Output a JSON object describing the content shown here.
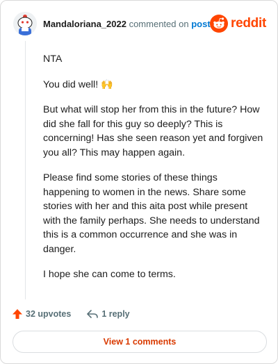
{
  "header": {
    "username": "Mandaloriana_2022",
    "verb": "commented on",
    "post_link": "post",
    "brand": "reddit"
  },
  "comment": {
    "paragraphs": [
      "NTA",
      "You did well! 🙌",
      "But what will stop her from this in the future? How did she fall for this guy so deeply? This is concerning! Has she seen reason yet and forgiven you all? This may happen again.",
      "Please find some stories of these things happening to women in the news. Share some stories with her and this aita post while present with the family perhaps. She needs to understand this is a common occurrence and she was in danger.",
      "I hope she can come to terms."
    ]
  },
  "actions": {
    "upvotes": "32 upvotes",
    "replies": "1 reply"
  },
  "footer": {
    "view_comments": "View 1 comments"
  },
  "colors": {
    "brand": "#ff4500",
    "link": "#0079d3",
    "upvote": "#ff4500",
    "view_button_text": "#d93a00"
  },
  "icons": {
    "avatar": "snoo-avatar",
    "brand": "reddit-logo-icon",
    "upvote": "upvote-arrow-icon",
    "reply": "reply-arrow-icon"
  }
}
